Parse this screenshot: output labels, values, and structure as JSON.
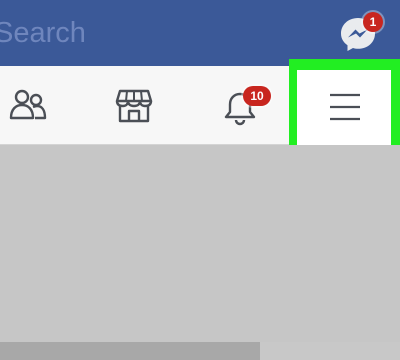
{
  "search": {
    "placeholder": "Search"
  },
  "messenger": {
    "icon": "messenger-icon",
    "badge": "1"
  },
  "nav": {
    "tabs": [
      {
        "id": "friends",
        "icon": "friends-icon"
      },
      {
        "id": "marketplace",
        "icon": "marketplace-icon"
      },
      {
        "id": "notifications",
        "icon": "bell-icon",
        "badge": "10"
      },
      {
        "id": "menu",
        "icon": "hamburger-menu-icon",
        "highlighted": true
      }
    ]
  },
  "colors": {
    "brand": "#3b5998",
    "badge": "#c8261f",
    "highlight": "#22ee22",
    "background": "#c6c6c6"
  }
}
